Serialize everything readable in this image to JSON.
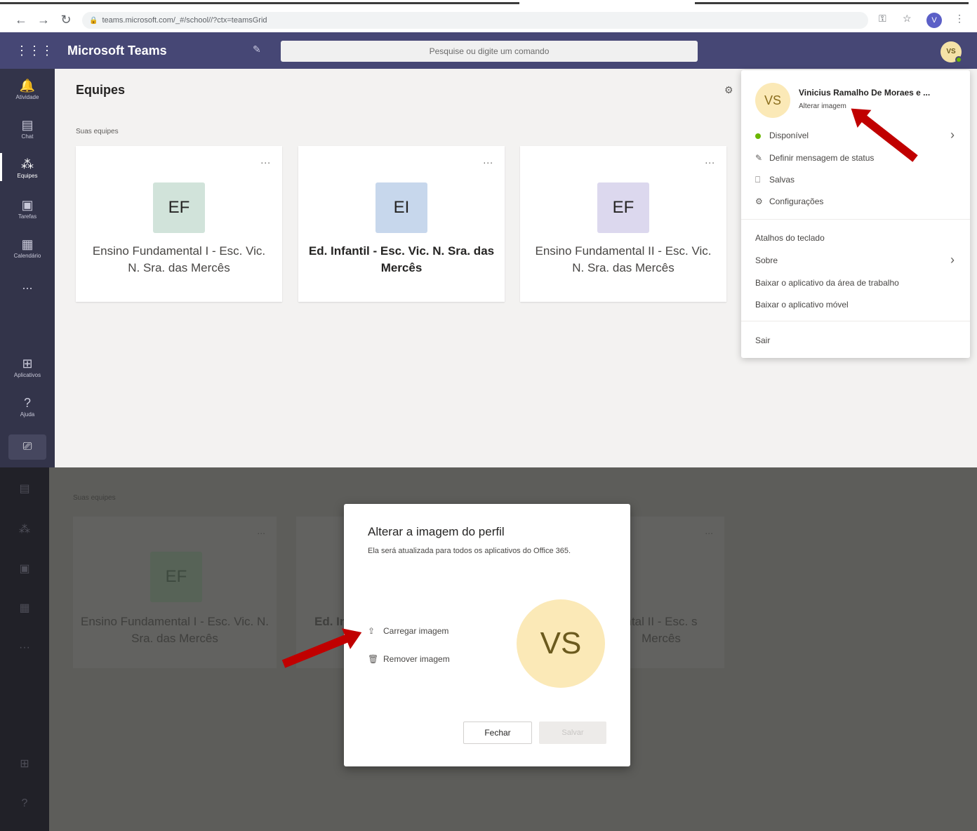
{
  "browser": {
    "url": "teams.microsoft.com/_#/school//?ctx=teamsGrid",
    "profile_initial": "V"
  },
  "header": {
    "app_title": "Microsoft Teams",
    "search_placeholder": "Pesquise ou digite um comando",
    "avatar_initials": "VS"
  },
  "rail": {
    "items": [
      {
        "label": "Atividade",
        "icon": "bell-icon"
      },
      {
        "label": "Chat",
        "icon": "chat-icon"
      },
      {
        "label": "Equipes",
        "icon": "teams-icon"
      },
      {
        "label": "Tarefas",
        "icon": "assignments-icon"
      },
      {
        "label": "Calendário",
        "icon": "calendar-icon"
      },
      {
        "label": "...",
        "icon": "more-icon"
      },
      {
        "label": "Aplicativos",
        "icon": "apps-icon"
      },
      {
        "label": "Ajuda",
        "icon": "help-icon"
      }
    ]
  },
  "main": {
    "title": "Equipes",
    "section_label": "Suas equipes",
    "teams": [
      {
        "initials": "EF",
        "name": "Ensino Fundamental I - Esc. Vic. N. Sra. das Mercês",
        "tile_color": "#d1e3da"
      },
      {
        "initials": "EI",
        "name": "Ed. Infantil - Esc. Vic. N. Sra. das Mercês",
        "tile_color": "#c7d7ec"
      },
      {
        "initials": "EF",
        "name": "Ensino Fundamental II - Esc. Vic. N. Sra. das Mercês",
        "tile_color": "#dcd8ee"
      }
    ],
    "more_label": "..."
  },
  "profile_menu": {
    "avatar_initials": "VS",
    "name": "Vinicius Ramalho De Moraes e ...",
    "change_image": "Alterar imagem",
    "status": "Disponível",
    "set_status_message": "Definir mensagem de status",
    "saved": "Salvas",
    "settings": "Configurações",
    "keyboard_shortcuts": "Atalhos do teclado",
    "about": "Sobre",
    "download_desktop": "Baixar o aplicativo da área de trabalho",
    "download_mobile": "Baixar o aplicativo móvel",
    "sign_out": "Sair"
  },
  "dim_background": {
    "section_label": "Suas equipes",
    "teams": [
      {
        "initials": "EF",
        "name": "Ensino Fundamental I - Esc. Vic. N. Sra. das Mercês"
      },
      {
        "initials": "",
        "name": "Ed. In"
      },
      {
        "initials": "",
        "name": "ntal II - Esc. s Mercês"
      }
    ]
  },
  "modal": {
    "title": "Alterar a imagem do perfil",
    "subtitle": "Ela será atualizada para todos os aplicativos do Office 365.",
    "upload": "Carregar imagem",
    "remove": "Remover imagem",
    "avatar_initials": "VS",
    "close_button": "Fechar",
    "save_button": "Salvar"
  },
  "colors": {
    "header_bg": "#464775",
    "rail_bg": "#33344a",
    "annotation_arrow": "#c00000",
    "status_available": "#6bb700"
  }
}
